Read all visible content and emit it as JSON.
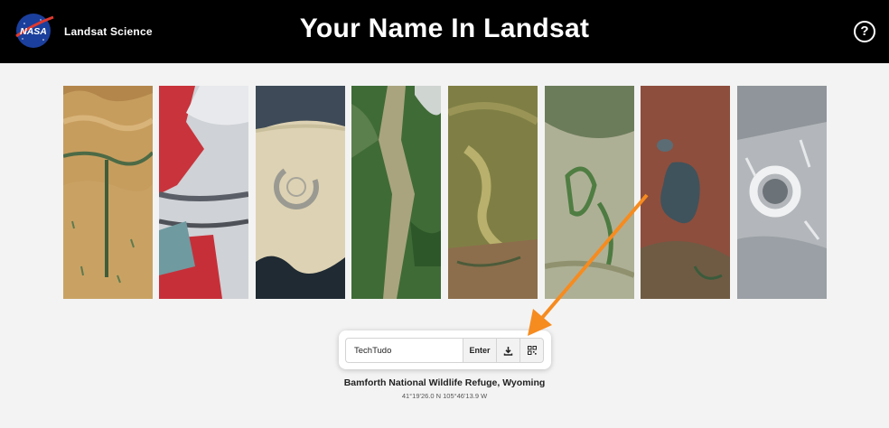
{
  "header": {
    "logo_text": "NASA",
    "brand": "Landsat Science",
    "title": "Your Name In Landsat",
    "help_glyph": "?"
  },
  "tiles": [
    {
      "name": "tile-desert-dunes",
      "color": "#c9a366"
    },
    {
      "name": "tile-glacier-red",
      "color": "#d9d9d9"
    },
    {
      "name": "tile-playa-circle",
      "color": "#dcd2b4"
    },
    {
      "name": "tile-green-mountains",
      "color": "#4f7a42"
    },
    {
      "name": "tile-olive-river",
      "color": "#8c8c4a"
    },
    {
      "name": "tile-green-plains",
      "color": "#a9ab8f"
    },
    {
      "name": "tile-red-lake",
      "color": "#8a4f3e"
    },
    {
      "name": "tile-crater-lake",
      "color": "#b9bcc0"
    }
  ],
  "form": {
    "input_value": "TechTudo",
    "enter_label": "Enter",
    "download_icon": "download-icon",
    "grid_icon": "qr-grid-icon"
  },
  "location": {
    "name": "Bamforth National Wildlife Refuge, Wyoming",
    "coords": "41°19'26.0 N 105°46'13.9 W"
  },
  "colors": {
    "header_bg": "#000000",
    "page_bg": "#f3f3f3",
    "annotation_arrow": "#f68b1f"
  }
}
